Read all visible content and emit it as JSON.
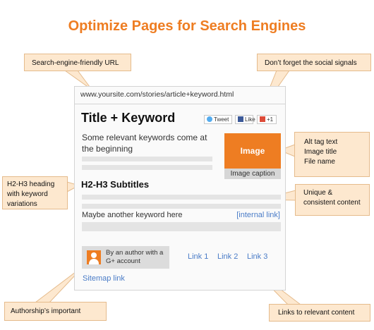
{
  "title": "Optimize Pages for Search Engines",
  "page": {
    "url": "www.yoursite.com/stories/article+keyword.html",
    "heading": "Title + Keyword",
    "social": {
      "tweet": "Tweet",
      "like": "Like",
      "plus": "+1"
    },
    "keyword_text": "Some relevant keywords come at the beginning",
    "image_label": "Image",
    "image_caption": "Image caption",
    "subtitle": "H2-H3 Subtitles",
    "another_keyword": "Maybe another keyword here",
    "internal_link": "[internal link]",
    "author_text": "By an author with a G+ account",
    "links": [
      "Link 1",
      "Link 2",
      "Link 3"
    ],
    "sitemap_link": "Sitemap link"
  },
  "callouts": {
    "url": "Search-engine-friendly URL",
    "social": "Don’t forget the social signals",
    "alt_lines": [
      "Alt tag text",
      "Image title",
      "File name"
    ],
    "h2_lines": [
      "H2-H3 heading",
      "with keyword",
      "variations"
    ],
    "unique_lines": [
      "Unique &",
      "consistent content"
    ],
    "authorship": "Authorship’s important",
    "links": "Links to relevant content"
  },
  "colors": {
    "accent": "#ee7d22",
    "callout_fill": "#fde8cf",
    "callout_border": "#e5bb8c",
    "link": "#4a7cc7",
    "placeholder_bar": "#e4e4e4"
  }
}
